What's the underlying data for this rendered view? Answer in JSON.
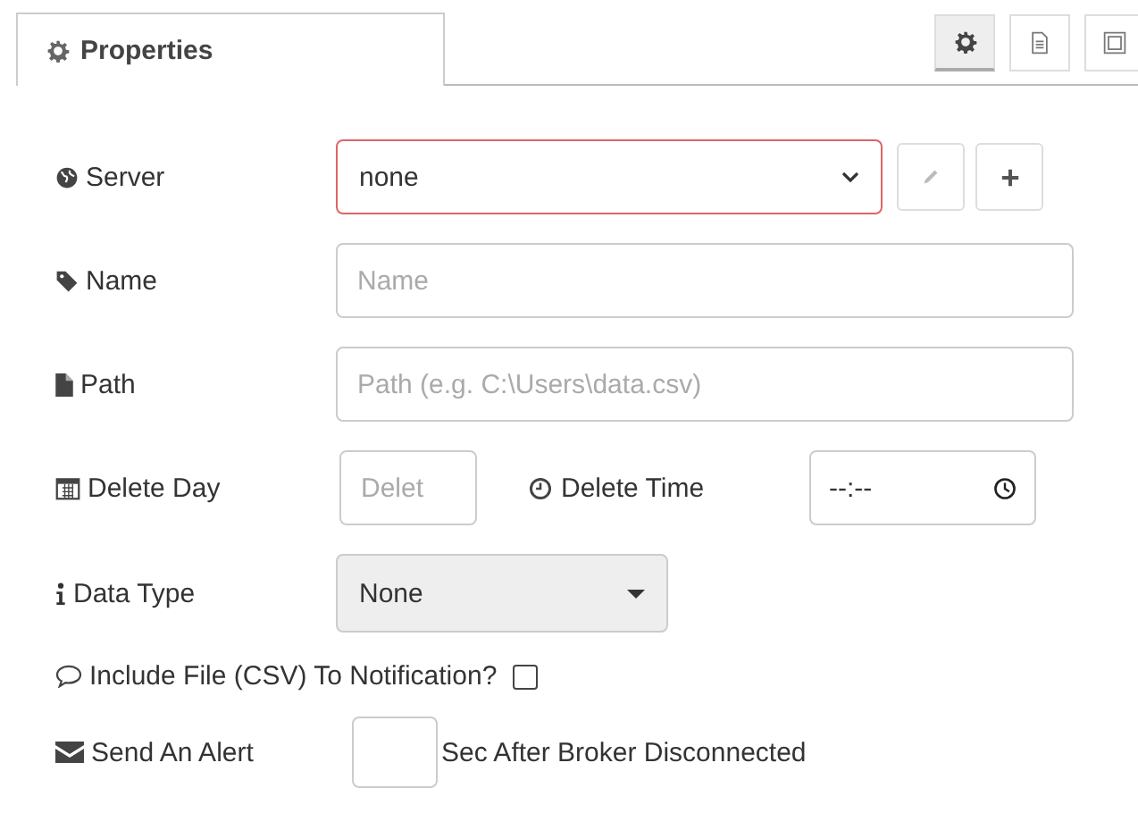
{
  "tabs": [
    {
      "label": "Properties",
      "selected": true
    }
  ],
  "toolbar": [
    {
      "kind": "gear",
      "selected": true
    },
    {
      "kind": "doc",
      "selected": false
    },
    {
      "kind": "frame",
      "selected": false
    }
  ],
  "server": {
    "label": "Server",
    "value": "none",
    "invalid": true
  },
  "name": {
    "label": "Name",
    "placeholder": "Name"
  },
  "path": {
    "label": "Path",
    "placeholder": "Path (e.g. C:\\Users\\data.csv)"
  },
  "delete_day": {
    "label": "Delete Day",
    "placeholder": "Delet"
  },
  "delete_time": {
    "label": "Delete Time",
    "value": "--:--"
  },
  "data_type": {
    "label": "Data Type",
    "value": "None"
  },
  "include_file": {
    "label": "Include File (CSV) To Notification?",
    "checked": false
  },
  "send_alert": {
    "label": "Send An Alert",
    "suffix": "Sec After Broker Disconnected"
  }
}
